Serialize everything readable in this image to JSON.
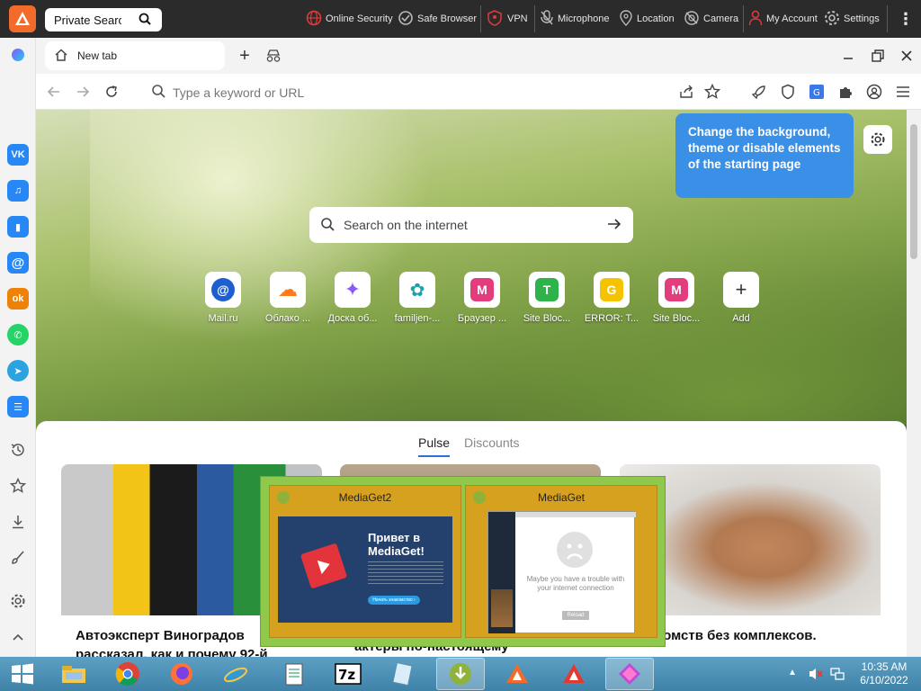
{
  "topbar": {
    "search_text": "Private Search",
    "items": [
      {
        "label": "Online Security",
        "icon": "globe-shield-icon"
      },
      {
        "label": "Safe Browser",
        "icon": "safe-browser-icon"
      },
      {
        "label": "VPN",
        "icon": "vpn-shield-icon"
      },
      {
        "label": "Microphone",
        "icon": "microphone-off-icon"
      },
      {
        "label": "Location",
        "icon": "location-off-icon"
      },
      {
        "label": "Camera",
        "icon": "camera-off-icon"
      },
      {
        "label": "My Account",
        "icon": "user-icon"
      },
      {
        "label": "Settings",
        "icon": "gear-icon"
      }
    ]
  },
  "tabs": [
    {
      "label": "New tab",
      "icon": "home-icon"
    }
  ],
  "addressbar": {
    "placeholder": "Type a keyword or URL"
  },
  "sidebar": {
    "apps": [
      {
        "name": "vk",
        "glyph": "VK",
        "color": "#2787f5"
      },
      {
        "name": "music",
        "glyph": "♫",
        "color": "#2787f5"
      },
      {
        "name": "stats",
        "glyph": "▮",
        "color": "#2787f5"
      },
      {
        "name": "mail",
        "glyph": "@",
        "color": "#2787f5"
      },
      {
        "name": "ok",
        "glyph": "ok",
        "color": "#ee8208"
      },
      {
        "name": "whatsapp",
        "glyph": "✆",
        "color": "#25d366"
      },
      {
        "name": "telegram",
        "glyph": "➤",
        "color": "#2aa3e0"
      },
      {
        "name": "lists",
        "glyph": "☰",
        "color": "#2787f5"
      }
    ]
  },
  "startpage": {
    "tooltip": "Change the background, theme or disable elements of the starting page",
    "search_placeholder": "Search on the internet",
    "tiles": [
      {
        "label": "Mail.ru",
        "glyph": "@",
        "color": "#1d5fd1"
      },
      {
        "label": "Облако ...",
        "glyph": "☁",
        "color": "#ff7a1a"
      },
      {
        "label": "Доска об...",
        "glyph": "✦",
        "color": "#8a5cf6"
      },
      {
        "label": "familjen-...",
        "glyph": "✿",
        "color": "#1aa0a8"
      },
      {
        "label": "Браузер ...",
        "glyph": "M",
        "color": "#e23d7d"
      },
      {
        "label": "Site Bloc...",
        "glyph": "T",
        "color": "#2db34a"
      },
      {
        "label": "ERROR: T...",
        "glyph": "G",
        "color": "#f6c300"
      },
      {
        "label": "Site Bloc...",
        "glyph": "M",
        "color": "#e23d7d"
      },
      {
        "label": "Add",
        "glyph": "+",
        "color": "#ffffff"
      }
    ],
    "feed_tabs": [
      "Pulse",
      "Discounts"
    ],
    "cards": [
      {
        "title": "Автоэксперт Виноградов рассказал, как и почему 92-й"
      },
      {
        "title": "актёры по-настоящему"
      },
      {
        "title": "знакомств без комплексов."
      }
    ]
  },
  "popup": {
    "windows": [
      {
        "title": "MediaGet2",
        "headline": "Привет в MediaGet!",
        "button": "Начать знакомство ›"
      },
      {
        "title": "MediaGet",
        "message": "Maybe you have a trouble with your internet connection",
        "reload": "Reload"
      }
    ]
  },
  "taskbar": {
    "apps": [
      "file-explorer",
      "chrome",
      "firefox",
      "internet-explorer",
      "notepad",
      "7zip",
      "notebook",
      "mediaget",
      "avast-browser",
      "avast-browser-2",
      "crystal"
    ],
    "time": "10:35 AM",
    "date": "6/10/2022"
  }
}
